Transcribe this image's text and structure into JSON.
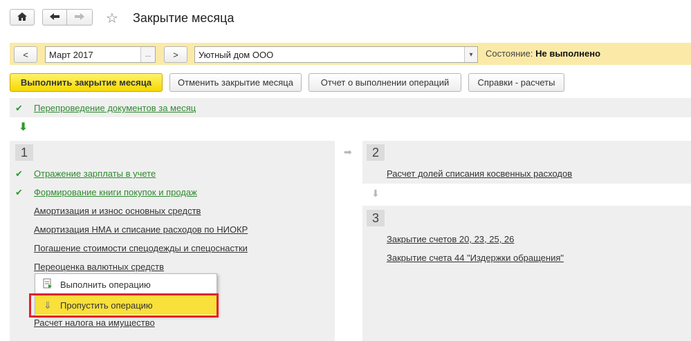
{
  "window": {
    "title": "Закрытие месяца",
    "home_icon": "home-icon",
    "back_icon": "arrow-left-icon",
    "forward_icon": "arrow-right-icon",
    "favorite_icon": "star-icon"
  },
  "toolbar": {
    "prev_label": "<",
    "period": "Март 2017",
    "period_select_label": "...",
    "next_label": ">",
    "organization": "Уютный дом ООО",
    "status_label": "Состояние:",
    "status_value": "Не выполнено"
  },
  "actions": {
    "run": "Выполнить закрытие месяца",
    "cancel": "Отменить закрытие месяца",
    "report": "Отчет о выполнении операций",
    "help": "Справки - расчеты"
  },
  "prestep": {
    "label": "Перепроведение документов за месяц"
  },
  "stage1": {
    "number": "1",
    "items": [
      {
        "label": "Отражение зарплаты в учете",
        "done": true
      },
      {
        "label": "Формирование книги покупок и продаж",
        "done": true
      },
      {
        "label": "Амортизация и износ основных средств",
        "done": false
      },
      {
        "label": "Амортизация НМА и списание расходов по НИОКР",
        "done": false
      },
      {
        "label": "Погашение стоимости спецодежды и спецоснастки",
        "done": false
      },
      {
        "label": "Переоценка валютных средств",
        "done": false
      },
      {
        "label": "Расчет налога на имущество",
        "done": false
      }
    ]
  },
  "stage2": {
    "number": "2",
    "items": [
      {
        "label": "Расчет долей списания косвенных расходов"
      }
    ]
  },
  "stage3": {
    "number": "3",
    "items": [
      {
        "label": "Закрытие счетов 20, 23, 25, 26"
      },
      {
        "label": "Закрытие счета 44 \"Издержки обращения\""
      }
    ]
  },
  "context_menu": {
    "items": [
      {
        "label": "Выполнить операцию",
        "icon": "run-operation-icon"
      },
      {
        "label": "Пропустить операцию",
        "icon": "skip-arrow-icon"
      }
    ],
    "highlight_color": "#e0242a"
  }
}
